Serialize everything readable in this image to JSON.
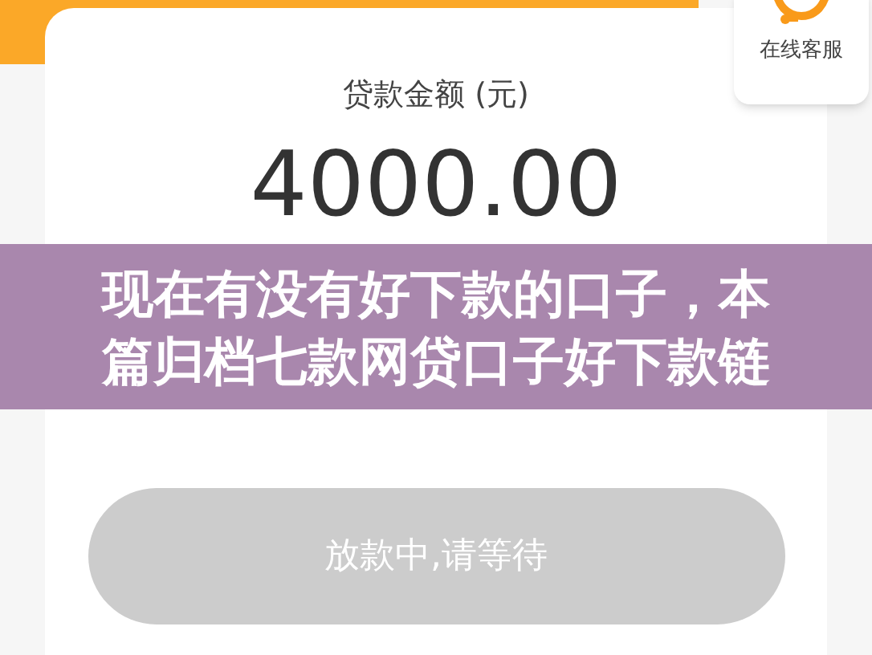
{
  "customer_service": {
    "label": "在线客服"
  },
  "loan": {
    "label": "贷款金额 (元)",
    "amount": "4000.00"
  },
  "overlay_title": {
    "lines": [
      "现在有没有好下款的口子，本",
      "篇归档七款网贷口子好下款链"
    ]
  },
  "action_button": {
    "label": "放款中,请等待",
    "disabled": true
  }
}
